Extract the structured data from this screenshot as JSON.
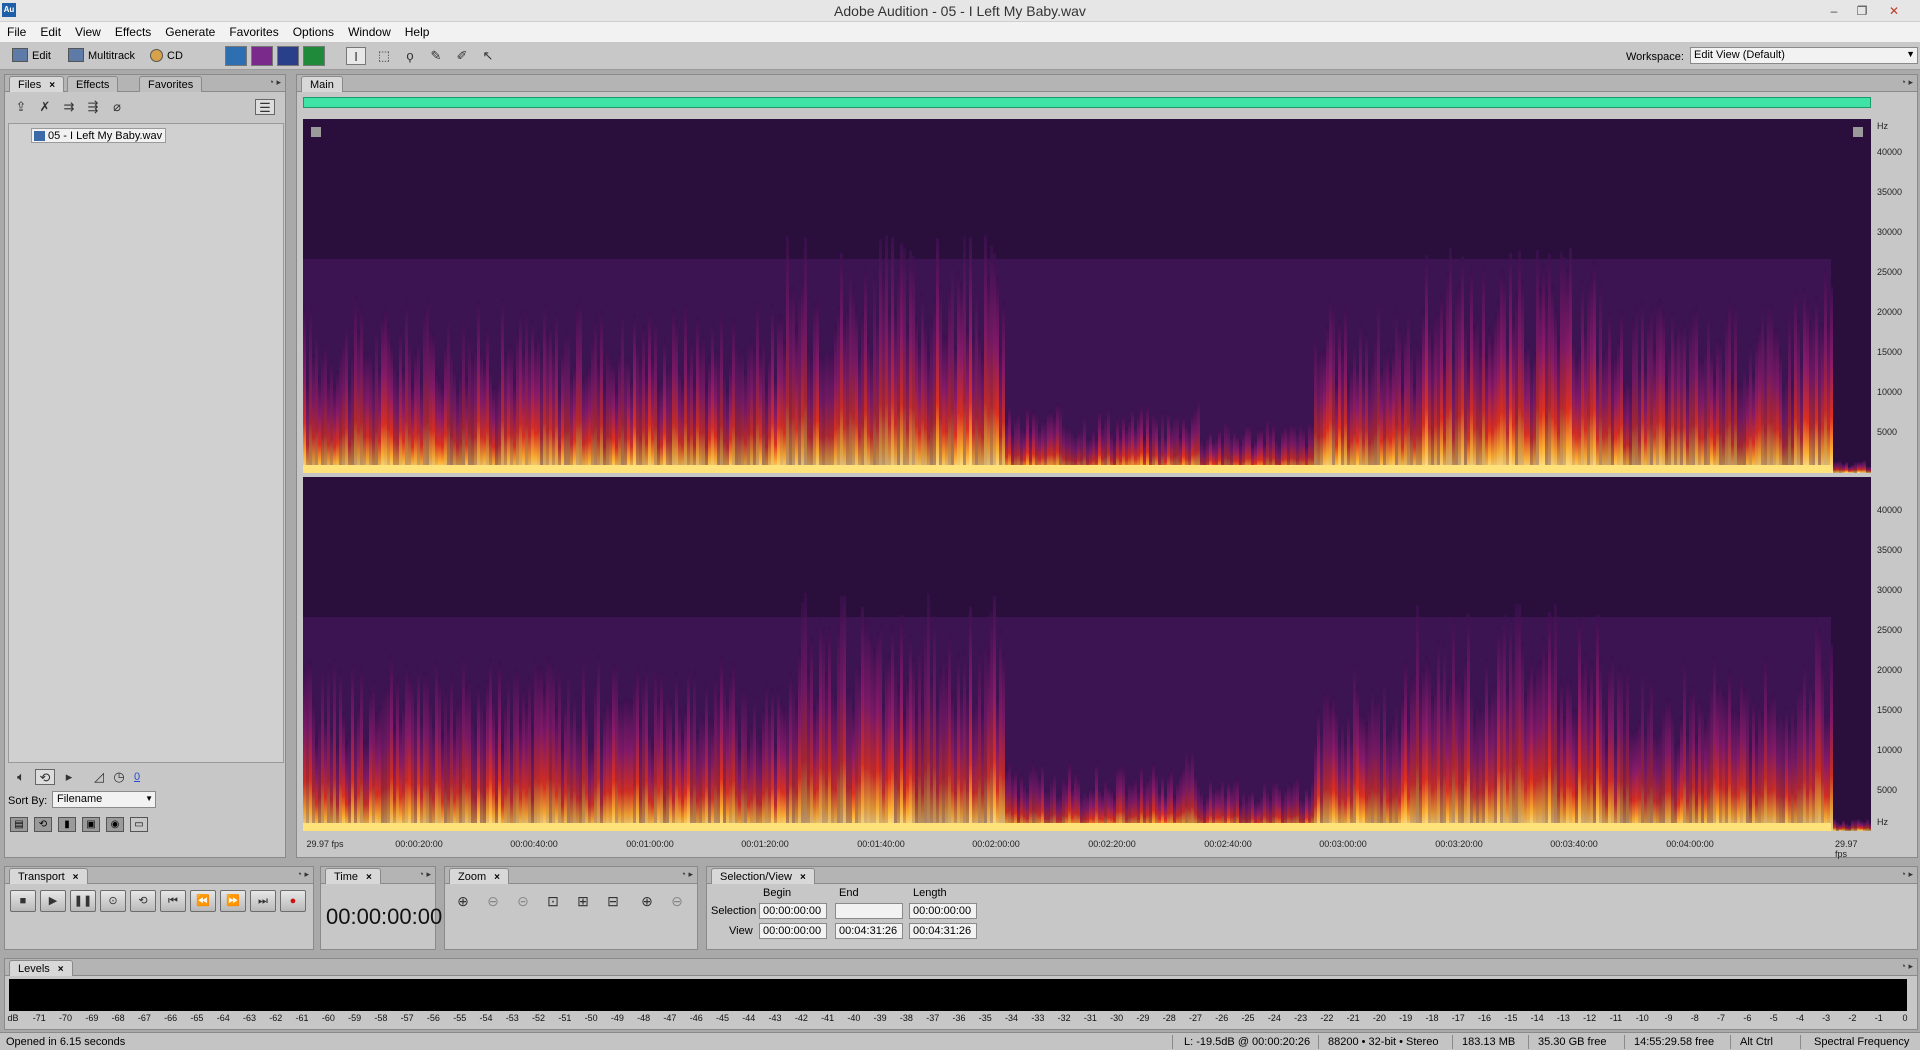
{
  "window": {
    "title": "Adobe Audition - 05 - I Left My Baby.wav",
    "app_logo": "Au"
  },
  "menu": [
    "File",
    "Edit",
    "View",
    "Effects",
    "Generate",
    "Favorites",
    "Options",
    "Window",
    "Help"
  ],
  "toolbar": {
    "edit": "Edit",
    "multitrack": "Multitrack",
    "cd": "CD",
    "workspace_label": "Workspace:",
    "workspace_value": "Edit View (Default)"
  },
  "files_panel": {
    "tabs": [
      "Files",
      "Effects",
      "Favorites"
    ],
    "file": "05 - I Left My Baby.wav",
    "counter": "0",
    "sort_label": "Sort By:",
    "sort_value": "Filename"
  },
  "main_panel": {
    "tab": "Main",
    "hz_unit": "Hz",
    "hz_ticks": [
      "40000",
      "35000",
      "30000",
      "25000",
      "20000",
      "15000",
      "10000",
      "5000"
    ],
    "fps_left": "29.97 fps",
    "fps_right": "29.97 fps",
    "time_ticks": [
      "00:00:20:00",
      "00:00:40:00",
      "00:01:00:00",
      "00:01:20:00",
      "00:01:40:00",
      "00:02:00:00",
      "00:02:20:00",
      "00:02:40:00",
      "00:03:00:00",
      "00:03:20:00",
      "00:03:40:00",
      "00:04:00:00"
    ]
  },
  "transport": {
    "tab": "Transport"
  },
  "time": {
    "tab": "Time",
    "display": "00:00:00:00"
  },
  "zoom": {
    "tab": "Zoom"
  },
  "selection_view": {
    "tab": "Selection/View",
    "headers": [
      "Begin",
      "End",
      "Length"
    ],
    "rows": [
      {
        "label": "Selection",
        "begin": "00:00:00:00",
        "end": "",
        "length": "00:00:00:00"
      },
      {
        "label": "View",
        "begin": "00:00:00:00",
        "end": "00:04:31:26",
        "length": "00:04:31:26"
      }
    ]
  },
  "levels": {
    "tab": "Levels",
    "scale": [
      "dB",
      "-71",
      "-70",
      "-69",
      "-68",
      "-67",
      "-66",
      "-65",
      "-64",
      "-63",
      "-62",
      "-61",
      "-60",
      "-59",
      "-58",
      "-57",
      "-56",
      "-55",
      "-54",
      "-53",
      "-52",
      "-51",
      "-50",
      "-49",
      "-48",
      "-47",
      "-46",
      "-45",
      "-44",
      "-43",
      "-42",
      "-41",
      "-40",
      "-39",
      "-38",
      "-37",
      "-36",
      "-35",
      "-34",
      "-33",
      "-32",
      "-31",
      "-30",
      "-29",
      "-28",
      "-27",
      "-26",
      "-25",
      "-24",
      "-23",
      "-22",
      "-21",
      "-20",
      "-19",
      "-18",
      "-17",
      "-16",
      "-15",
      "-14",
      "-13",
      "-12",
      "-11",
      "-10",
      "-9",
      "-8",
      "-7",
      "-6",
      "-5",
      "-4",
      "-3",
      "-2",
      "-1",
      "0"
    ]
  },
  "status": {
    "message": "Opened in 6.15 seconds",
    "level": "L: -19.5dB @ 00:00:20:26",
    "format": "88200 • 32-bit • Stereo",
    "size": "183.13 MB",
    "free": "35.30 GB free",
    "free_time": "14:55:29.58 free",
    "keys": "Alt Ctrl",
    "view": "Spectral Frequency"
  },
  "colors": {
    "overview": "#3fe3a5",
    "spectrum_low": "#1a0a22",
    "spectrum_high": "#ffd24a"
  }
}
